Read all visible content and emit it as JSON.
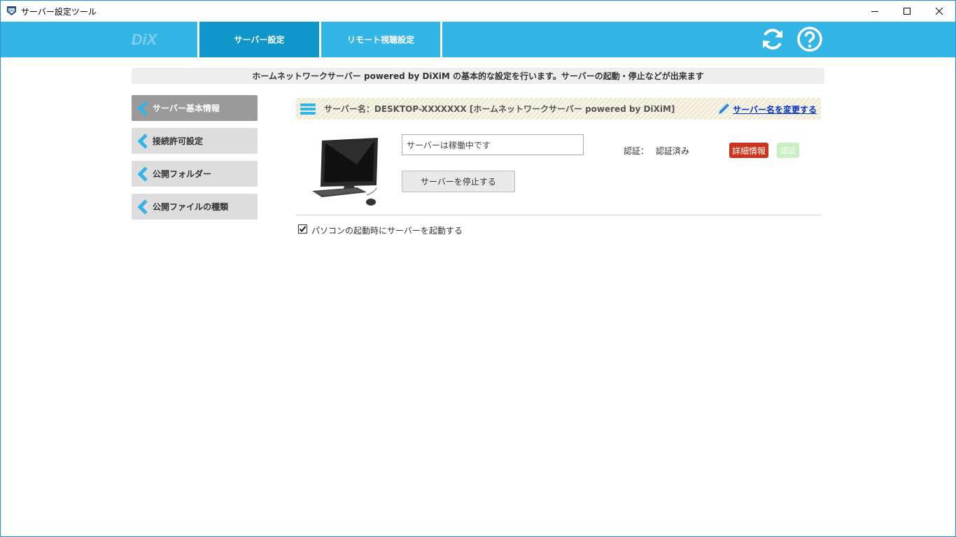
{
  "window": {
    "title": "サーバー設定ツール",
    "minimize_icon": "minimize-icon",
    "maximize_icon": "maximize-icon",
    "close_icon": "close-icon"
  },
  "header": {
    "logo_text": "DiXiM logo",
    "tabs": [
      {
        "label": "サーバー設定",
        "active": true
      },
      {
        "label": "リモート視聴設定",
        "active": false
      }
    ],
    "refresh_icon": "refresh-icon",
    "help_icon": "help-icon",
    "accent_color": "#33b5e5",
    "active_tab_color": "#0e97c8"
  },
  "banner": {
    "text": "ホームネットワークサーバー powered by DiXiM の基本的な設定を行います。サーバーの起動・停止などが出来ます"
  },
  "sidebar": {
    "items": [
      {
        "label": "サーバー基本情報",
        "active": true
      },
      {
        "label": "接続許可設定",
        "active": false
      },
      {
        "label": "公開フォルダー",
        "active": false
      },
      {
        "label": "公開ファイルの種類",
        "active": false
      }
    ]
  },
  "main": {
    "server_name": "サーバー名：DESKTOP-XXXXXXX [ホームネットワークサーバー powered by DiXiM]",
    "rename_link": "サーバー名を変更する",
    "status_text": "サーバーは稼働中です",
    "stop_button": "サーバーを停止する",
    "auth_label": "認証：",
    "auth_value": "認証済み",
    "detail_button": "詳細情報",
    "auth_button": "認証",
    "autostart_label": "パソコンの起動時にサーバーを起動する",
    "autostart_checked": true
  }
}
